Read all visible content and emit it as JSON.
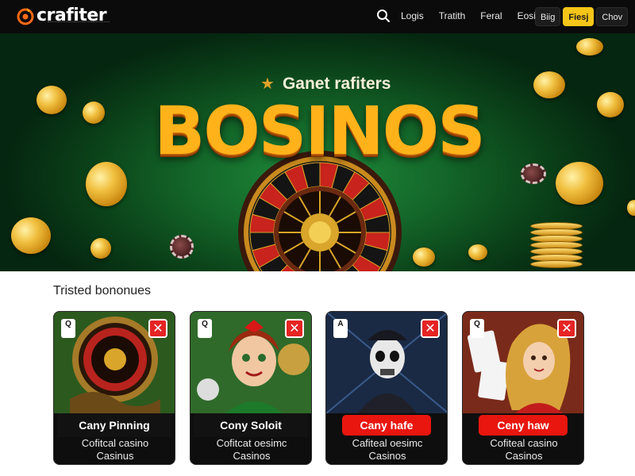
{
  "header": {
    "logo_text": "crafiter",
    "nav": [
      "Logis",
      "Tratith",
      "Feral",
      "Eosit"
    ],
    "buttons": [
      "Biig",
      "Fiesj",
      "Chov"
    ]
  },
  "hero": {
    "tagline": "Ganet rafiters",
    "title": "BOSINOS"
  },
  "section": {
    "title": "Tristed bononues"
  },
  "cards": [
    {
      "badge": "Q",
      "cta": "Cany Pinning",
      "cta_style": "dark",
      "desc_line1": "Cofitcal casino",
      "desc_line2": "Casinus"
    },
    {
      "badge": "Q",
      "cta": "Cony Soloit",
      "cta_style": "dark",
      "desc_line1": "Cofitcat oesimc",
      "desc_line2": "Casinos"
    },
    {
      "badge": "A",
      "cta": "Cany hafe",
      "cta_style": "red",
      "desc_line1": "Cafiteal oesimc",
      "desc_line2": "Casinos"
    },
    {
      "badge": "Q",
      "cta": "Ceny haw",
      "cta_style": "red",
      "desc_line1": "Cofiteal casino",
      "desc_line2": "Casinos"
    }
  ],
  "colors": {
    "accent": "#f5c518",
    "cta_red": "#e8160f",
    "hero_green": "#14682a",
    "title_gold": "#ffb21a"
  },
  "icons": {
    "search": "search-icon",
    "close": "close-icon",
    "star": "star-icon"
  }
}
